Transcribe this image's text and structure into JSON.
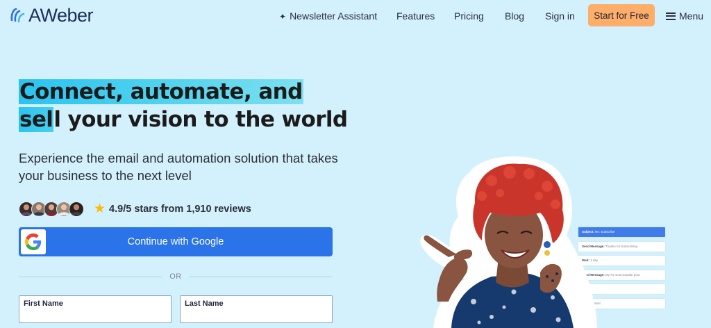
{
  "brand": {
    "name": "AWeber",
    "accent": "#2b73e8",
    "cta_color": "#ffae6a",
    "highlight_color": "#2ac3f0"
  },
  "nav": {
    "assistant": "Newsletter Assistant",
    "features": "Features",
    "pricing": "Pricing",
    "blog": "Blog",
    "signin": "Sign in",
    "cta": "Start for Free",
    "menu": "Menu"
  },
  "hero": {
    "headline_part1": "Connect, automate, and",
    "headline_sel": "sel",
    "headline_l": "l",
    "headline_rest": " your vision to the world",
    "subhead": "Experience the email and automation solution that takes your business to the next level",
    "rating_text": "4.9/5 stars from 1,910 reviews",
    "rating_value": 4.9,
    "google_button": "Continue with Google",
    "or_text": "OR",
    "first_name_label": "First Name",
    "last_name_label": "Last Name",
    "first_name_value": "",
    "last_name_value": ""
  },
  "email_flow": [
    {
      "key": "Subject:",
      "val": "Re: Subscribe",
      "active": true
    },
    {
      "key": "Send Message:",
      "val": "Thanks for Subscribing",
      "active": false
    },
    {
      "key": "Wait:",
      "val": "1 day",
      "active": false
    },
    {
      "key": "Send Message:",
      "val": "My #1 most popular post",
      "active": false
    },
    {
      "key": "",
      "val": "",
      "active": false
    },
    {
      "key": "",
      "val": "s is important",
      "active": false
    }
  ]
}
